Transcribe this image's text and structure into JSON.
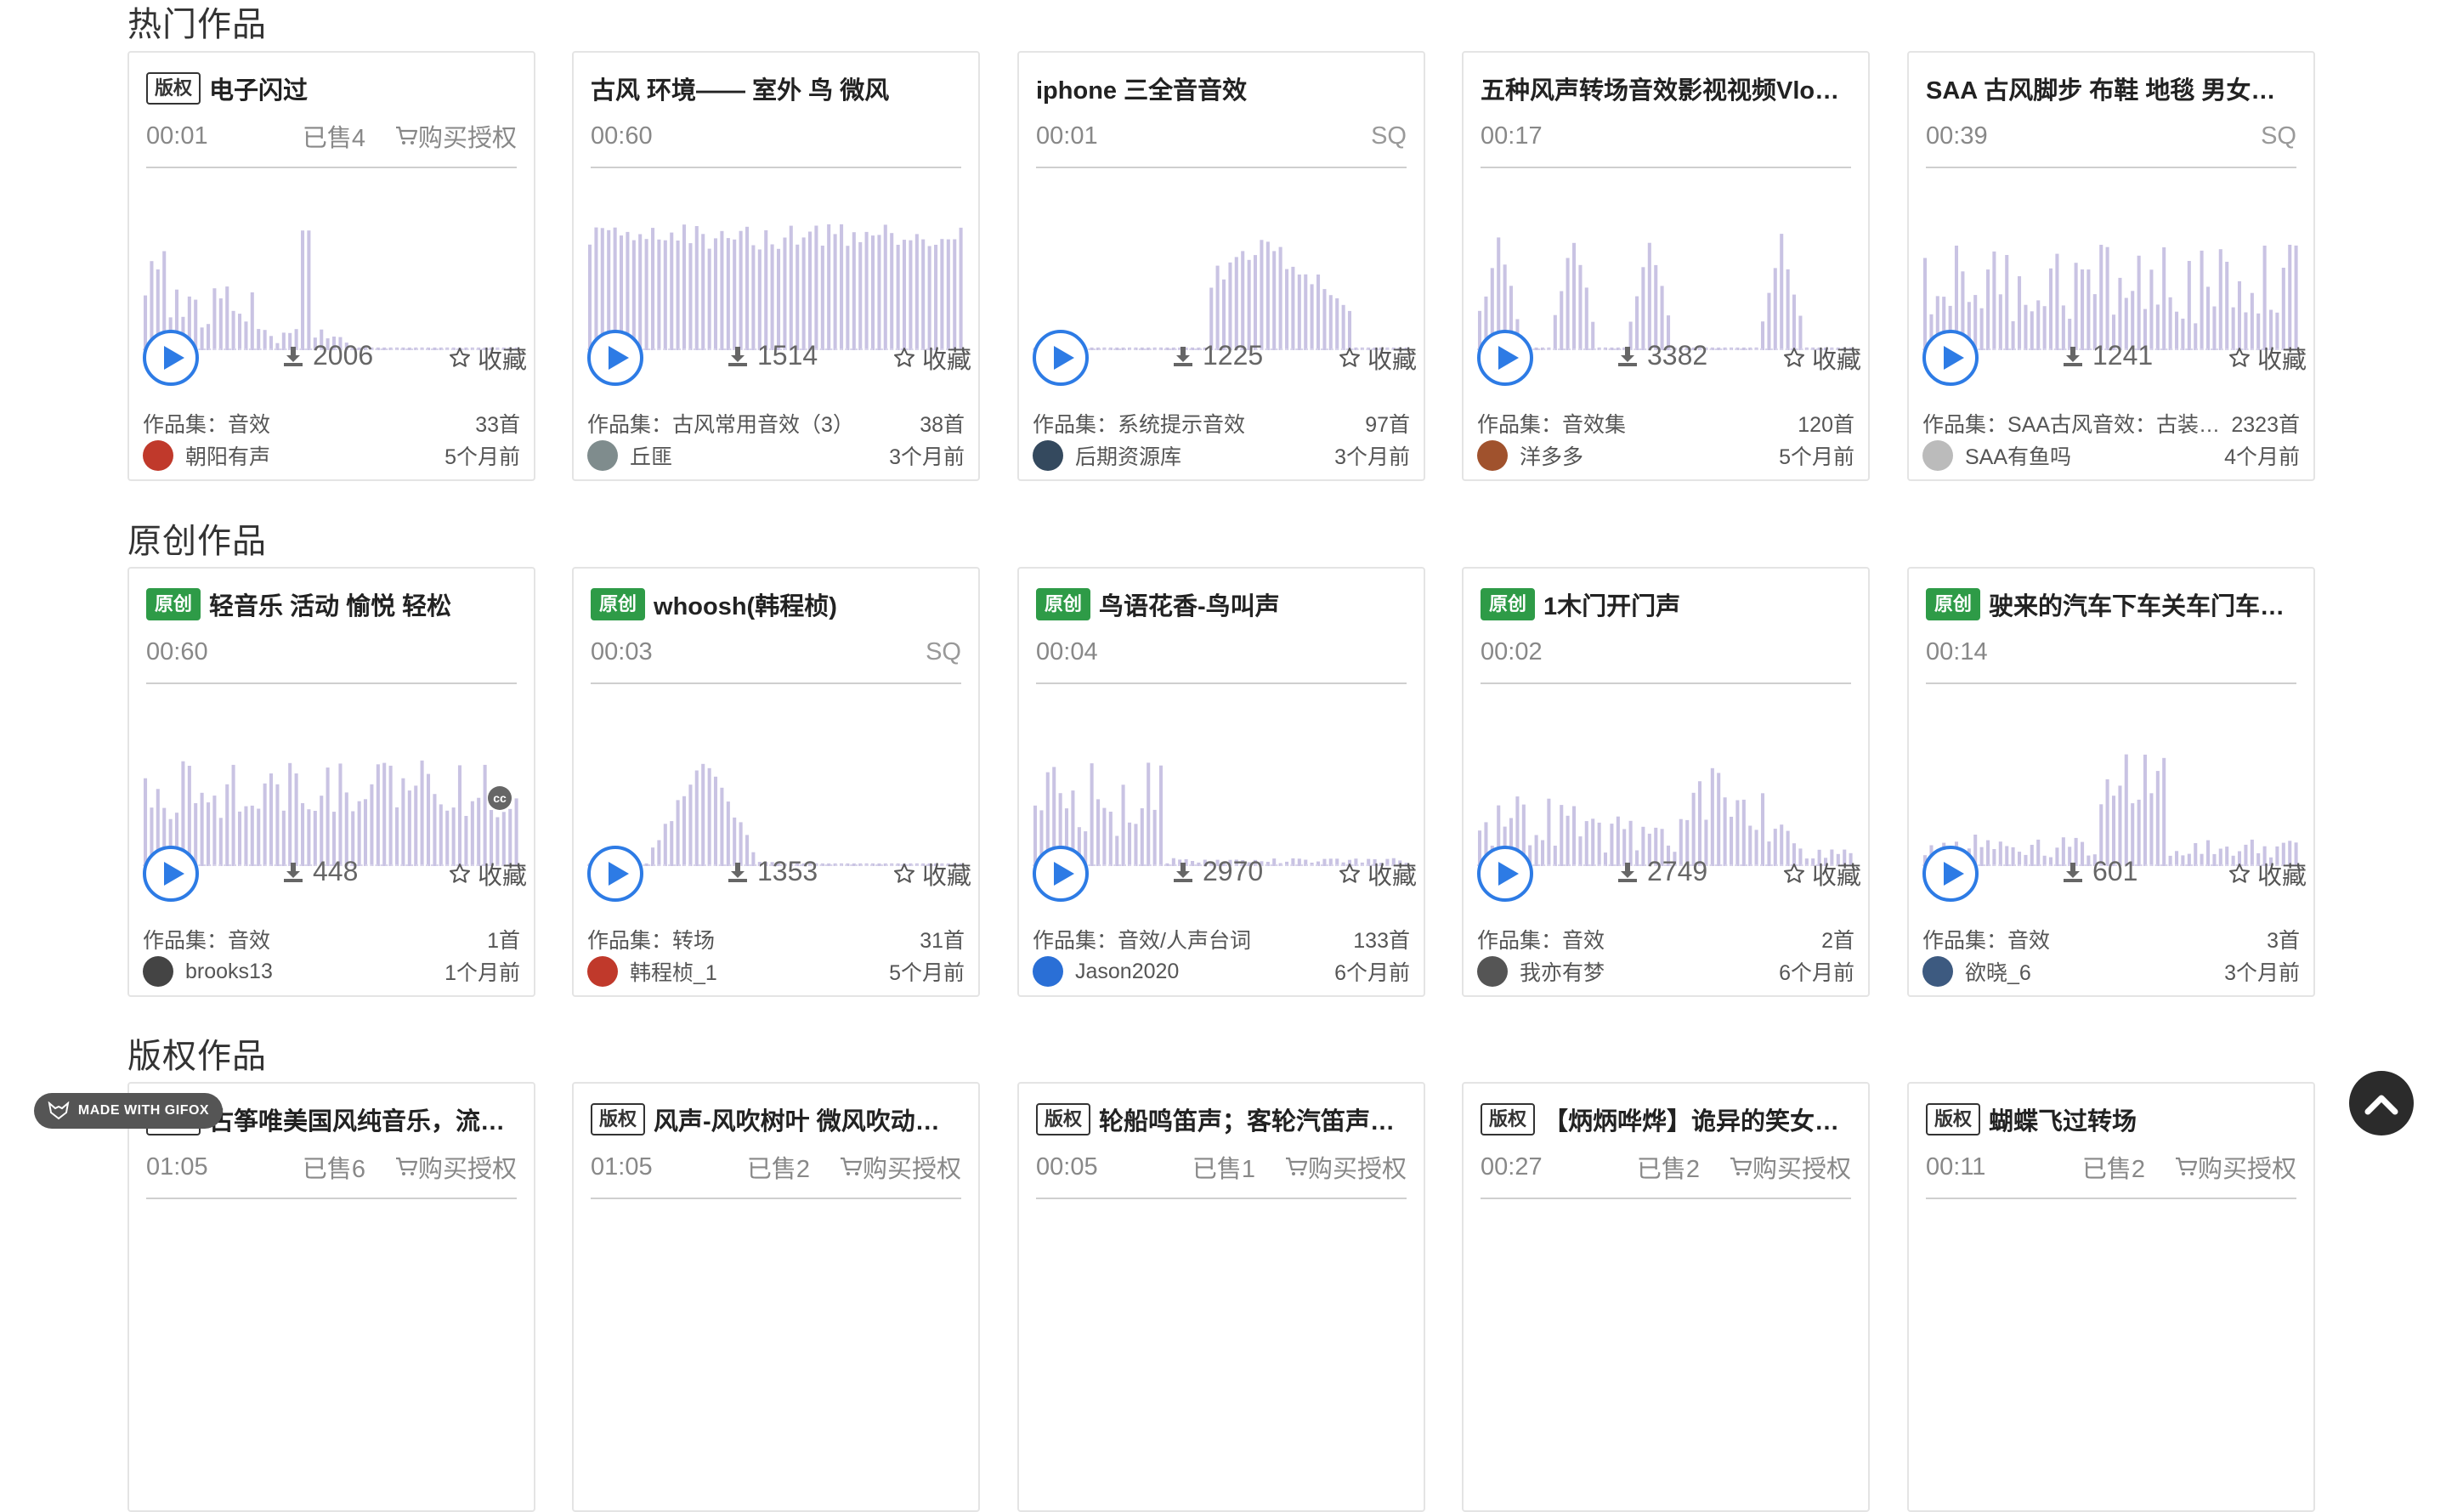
{
  "sections": [
    {
      "title": "热门作品"
    },
    {
      "title": "原创作品"
    },
    {
      "title": "版权作品"
    }
  ],
  "labels": {
    "favorite": "收藏",
    "collection_prefix": "作品集：",
    "buy": "购买授权",
    "sq": "SQ"
  },
  "hot": [
    {
      "tag": "版权",
      "title": "电子闪过",
      "duration": "00:01",
      "sold": "已售4",
      "buy": true,
      "downloads": "2006",
      "collection": "音效",
      "count": "33首",
      "author": "朝阳有声",
      "time": "5个月前",
      "wave": "a"
    },
    {
      "tag": "",
      "title": "古风 环境—— 室外 鸟 微风",
      "duration": "00:60",
      "downloads": "1514",
      "collection": "古风常用音效（3）",
      "count": "38首",
      "author": "丘匪",
      "time": "3个月前",
      "wave": "b"
    },
    {
      "tag": "",
      "title": "iphone 三全音音效",
      "duration": "00:01",
      "sq": true,
      "downloads": "1225",
      "collection": "系统提示音效",
      "count": "97首",
      "author": "后期资源库",
      "time": "3个月前",
      "wave": "c"
    },
    {
      "tag": "",
      "title": "五种风声转场音效影视视频Vlog…",
      "duration": "00:17",
      "downloads": "3382",
      "collection": "音效集",
      "count": "120首",
      "author": "洋多多",
      "time": "5个月前",
      "wave": "d"
    },
    {
      "tag": "",
      "title": "SAA 古风脚步 布鞋 地毯 男女通…",
      "duration": "00:39",
      "sq": true,
      "downloads": "1241",
      "collection": "SAA古风音效：古装 …",
      "count": "2323首",
      "author": "SAA有鱼吗",
      "time": "4个月前",
      "wave": "e"
    }
  ],
  "original": [
    {
      "tag": "原创",
      "title": "轻音乐 活动 愉悦 轻松",
      "duration": "00:60",
      "downloads": "448",
      "collection": "音效",
      "count": "1首",
      "author": "brooks13",
      "time": "1个月前",
      "wave": "f",
      "cc": "cc"
    },
    {
      "tag": "原创",
      "title": "whoosh(韩程桢)",
      "duration": "00:03",
      "sq": true,
      "downloads": "1353",
      "collection": "转场",
      "count": "31首",
      "author": "韩程桢_1",
      "time": "5个月前",
      "wave": "g"
    },
    {
      "tag": "原创",
      "title": "鸟语花香-鸟叫声",
      "duration": "00:04",
      "downloads": "2970",
      "collection": "音效/人声台词",
      "count": "133首",
      "author": "Jason2020",
      "time": "6个月前",
      "wave": "h"
    },
    {
      "tag": "原创",
      "title": "1木门开门声",
      "duration": "00:02",
      "downloads": "2749",
      "collection": "音效",
      "count": "2首",
      "author": "我亦有梦",
      "time": "6个月前",
      "wave": "i"
    },
    {
      "tag": "原创",
      "title": "驶来的汽车下车关车门车迅…",
      "duration": "00:14",
      "downloads": "601",
      "collection": "音效",
      "count": "3首",
      "author": "欲晓_6",
      "time": "3个月前",
      "wave": "j"
    }
  ],
  "copyright": [
    {
      "tag": "版权",
      "title": "古筝唯美国风纯音乐，流…",
      "duration": "01:05",
      "sold": "已售6",
      "buy": true
    },
    {
      "tag": "版权",
      "title": "风声-风吹树叶 微风吹动…",
      "duration": "01:05",
      "sold": "已售2",
      "buy": true
    },
    {
      "tag": "版权",
      "title": "轮船鸣笛声；客轮汽笛声…",
      "duration": "00:05",
      "sold": "已售1",
      "buy": true
    },
    {
      "tag": "版权",
      "title": "【炳炳哗烨】诡异的笑女…",
      "duration": "00:27",
      "sold": "已售2",
      "buy": true
    },
    {
      "tag": "版权",
      "title": "蝴蝶飞过转场",
      "duration": "00:11",
      "sold": "已售2",
      "buy": true
    }
  ],
  "overlay": {
    "gifox": "MADE WITH GIFOX"
  },
  "colors": {
    "accent": "#2d7be5",
    "original_tag": "#2e9b47",
    "wave": "#c9c3e3",
    "back_to_top": "#2b2b2b"
  },
  "icons": {
    "play": "play-icon",
    "download": "download-icon",
    "favorite": "star-icon",
    "cart": "cart-icon",
    "back_to_top": "chevron-up-icon"
  }
}
